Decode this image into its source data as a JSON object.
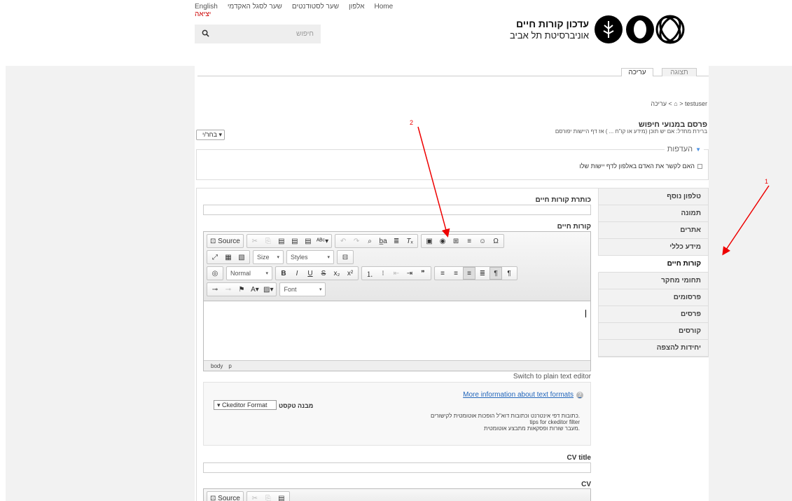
{
  "topnav": {
    "english": "English",
    "admin_portal": "שער לסגל האקדמי",
    "student_portal": "שער לסטודנטים",
    "directory": "אלפון",
    "home": "Home",
    "logout": "יציאה"
  },
  "search": {
    "placeholder": "חיפוש"
  },
  "logo": {
    "line1": "עדכון קורות חיים",
    "line2": "אוניברסיטת תל אביב"
  },
  "tabs": {
    "edit": "עריכה",
    "view": "תצוגה"
  },
  "breadcrumb": "עריכה < ⌂ > testuser",
  "form": {
    "title": "פרסם במנועי חיפוש",
    "description": "ברירת מחדל: אם יש תוכן (מידע או קו\"ח ... ) אז דף היישות יפורסם",
    "select_label": "בחר/י ▾"
  },
  "preferences": {
    "legend": "העדפות",
    "checkbox_label": "האם לקשר את האדם באלפון לדף יישות שלו"
  },
  "vertical_tabs": [
    "טלפון נוסף",
    "תמונה",
    "אתרים",
    "מידע כללי",
    "קורות חיים",
    "תחומי מחקר",
    "פרסומים",
    "פרסים",
    "קורסים",
    "יחידות להצפה"
  ],
  "fields": {
    "cv_heading_label": "כותרת קורות חיים",
    "cv_label": "קורות חיים",
    "cv_title_label": "CV title",
    "cv_en_label": "CV"
  },
  "editor": {
    "source": "Source",
    "size": "Size",
    "styles": "Styles",
    "normal": "Normal",
    "font": "Font",
    "path_body": "body",
    "path_p": "p"
  },
  "switch_link": "Switch to plain text editor",
  "text_format": {
    "more_info": "More information about text formats",
    "label": "מבנה טקסט",
    "selected": "▾ Ckeditor Format",
    "tips": [
      "כתובות דפי אינטרנט וכתובות דוא\"ל הופכות אוטומטית לקישורים.",
      "tips for ckeditor filter",
      "מעבר שורות ופסקאות מתבצע אוטומטית."
    ]
  },
  "annotations": {
    "one": "1",
    "two": "2"
  }
}
